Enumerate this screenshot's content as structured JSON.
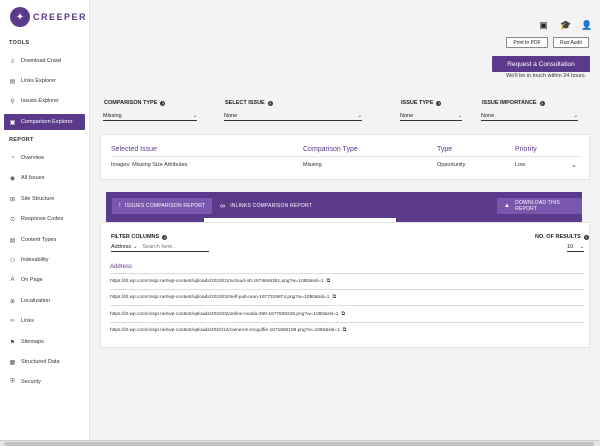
{
  "brand": {
    "name": "CREEPER",
    "mark": "✦"
  },
  "sidebar": {
    "tools_label": "TOOLS",
    "report_label": "REPORT",
    "tools": [
      {
        "label": "Download Crawl",
        "icon": "⇩"
      },
      {
        "label": "Links Explorer",
        "icon": "▤"
      },
      {
        "label": "Issues Explorer",
        "icon": "⚲"
      },
      {
        "label": "Comparison Explorer",
        "icon": "▣"
      }
    ],
    "report": [
      {
        "label": "Overview",
        "icon": "◔"
      },
      {
        "label": "All Issues",
        "icon": "◉"
      },
      {
        "label": "Site Structure",
        "icon": "⊞"
      },
      {
        "label": "Response Codes",
        "icon": "⊙"
      },
      {
        "label": "Content Types",
        "icon": "▤"
      },
      {
        "label": "Indexability",
        "icon": "⚇"
      },
      {
        "label": "On Page",
        "icon": "A"
      },
      {
        "label": "Localization",
        "icon": "⊕"
      },
      {
        "label": "Links",
        "icon": "∞"
      },
      {
        "label": "Sitemaps",
        "icon": "⚑"
      },
      {
        "label": "Structured Data",
        "icon": "▦"
      },
      {
        "label": "Security",
        "icon": "⛨"
      }
    ]
  },
  "header": {
    "print_label": "Print to PDF",
    "run_label": "Run Audit",
    "consult_label": "Request a Consultation",
    "consult_note": "We'll be in touch within 24 hours."
  },
  "filters": [
    {
      "label": "COMPARISON TYPE",
      "value": "Missing"
    },
    {
      "label": "SELECT ISSUE",
      "value": "None"
    },
    {
      "label": "ISSUE TYPE",
      "value": "None"
    },
    {
      "label": "ISSUE IMPORTANCE",
      "value": "None"
    }
  ],
  "issue_table": {
    "headers": [
      "Selected Issue",
      "Comparison Type",
      "Type",
      "Priority"
    ],
    "row": [
      "Images: Missing Size Attributes",
      "Missing",
      "Opportunity",
      "Low"
    ]
  },
  "report_tabs": {
    "tabs": [
      "ISSUES COMPARISON REPORT",
      "INLINKS COMPARISON REPORT"
    ],
    "download_label": "DOWNLOAD THIS REPORT"
  },
  "results": {
    "filter_label": "FILTER COLUMNS",
    "filter_column": "Address",
    "search_placeholder": "Search here..",
    "results_label": "NO. OF RESULTS",
    "results_value": "10",
    "column_header": "Address",
    "rows": [
      "https://i0.wp.com/crispr.net/wp-content/uploads/2023/01/Ivcloud-ott-1674646351.png?w=1080&ssl=1",
      "https://i0.wp.com/crispr.net/wp-content/uploads/2023/02/self-pub-man-1677319874.png?w=1080&ssl=1",
      "https://i0.wp.com/crispr.net/wp-content/uploads/2023/02/online-media-360-1677600229.png?w=1080&ssl=1",
      "https://i0.wp.com/crispr.net/wp-content/uploads/2022/12/cameron-mcguffie-1671885109.png?w=1080&ssl=1"
    ]
  },
  "colors": {
    "accent": "#5b3a8c",
    "accent_light": "#7857ad"
  }
}
